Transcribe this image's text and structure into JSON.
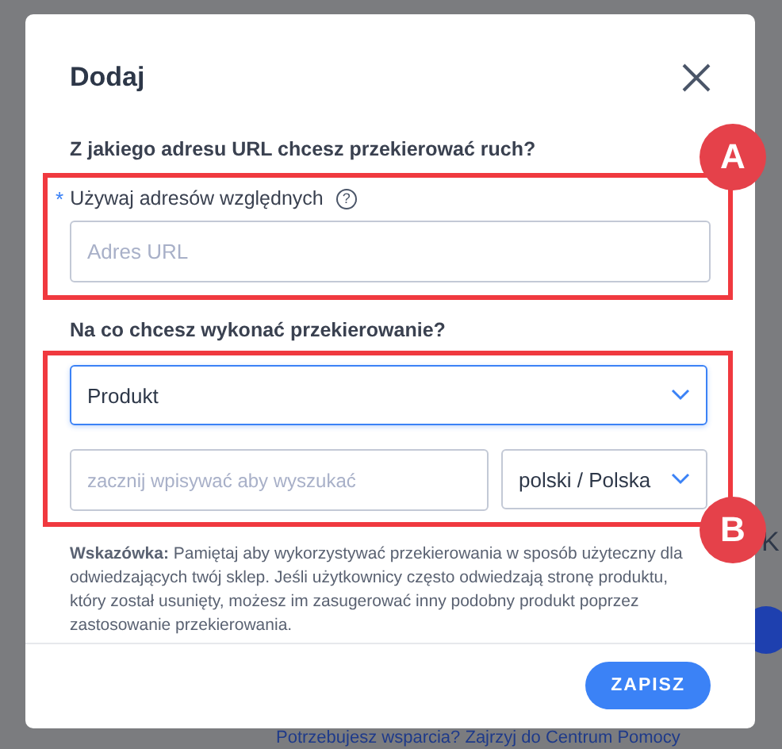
{
  "background": {
    "side_letter": "K",
    "footer_text": "Potrzebujesz wsparcia? Zajrzyj do Centrum Pomocy"
  },
  "dialog": {
    "title": "Dodaj",
    "source": {
      "question": "Z jakiego adresu URL chcesz przekierować ruch?",
      "required_mark": "*",
      "label": "Używaj adresów względnych",
      "help": "?",
      "placeholder": "Adres URL",
      "annotation": "A"
    },
    "target": {
      "question": "Na co chcesz wykonać przekierowanie?",
      "type_value": "Produkt",
      "type_focused": true,
      "search_placeholder": "zacznij wpisywać aby wyszukać",
      "language": "polski / Polska",
      "annotation": "B"
    },
    "hint": "**Wskazówka:** Pamiętaj aby wykorzystywać przekierowania w sposób użyteczny dla odwiedzających twój sklep. Jeśli użytkownicy często odwiedzają stronę produktu, który został usunięty, możesz im zasugerować inny podobny produkt poprzez zastosowanie przekierowania.",
    "save_button": "ZAPISZ"
  }
}
